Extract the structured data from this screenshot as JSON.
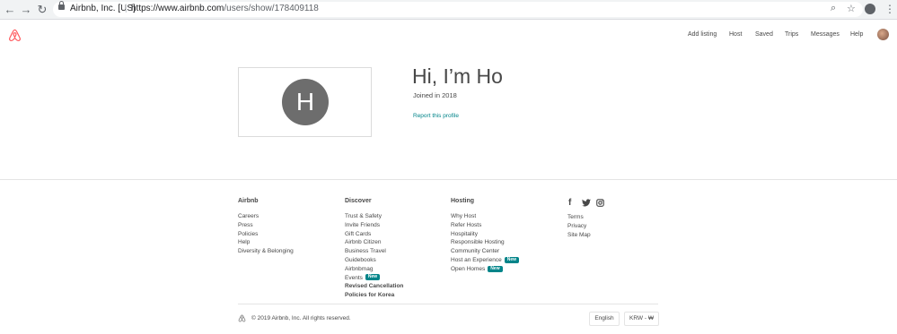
{
  "browser": {
    "organization": "Airbnb, Inc. [US]",
    "url_host": "https://www.airbnb.com",
    "url_path": "/users/show/178409118"
  },
  "header": {
    "nav": [
      "Add listing",
      "Host",
      "Saved",
      "Trips",
      "Messages",
      "Help"
    ]
  },
  "profile": {
    "avatar_initial": "H",
    "greeting": "Hi, I’m Ho",
    "joined": "Joined in 2018",
    "report_link": "Report this profile"
  },
  "footer": {
    "airbnb": {
      "title": "Airbnb",
      "links": [
        "Careers",
        "Press",
        "Policies",
        "Help",
        "Diversity & Belonging"
      ]
    },
    "discover": {
      "title": "Discover",
      "links": [
        "Trust & Safety",
        "Invite Friends",
        "Gift Cards",
        "Airbnb Citizen",
        "Business Travel",
        "Guidebooks",
        "Airbnbmag"
      ],
      "events_label": "Events",
      "events_badge": "New",
      "revised_line1": "Revised Cancellation",
      "revised_line2": "Policies for Korea"
    },
    "hosting": {
      "title": "Hosting",
      "links": [
        "Why Host",
        "Refer Hosts",
        "Hospitality",
        "Responsible Hosting",
        "Community Center"
      ],
      "experience_label": "Host an Experience",
      "experience_badge": "New",
      "homes_label": "Open Homes",
      "homes_badge": "New"
    },
    "misc": {
      "links": [
        "Terms",
        "Privacy",
        "Site Map"
      ]
    },
    "copyright": "© 2019 Airbnb, Inc. All rights reserved.",
    "language": "English",
    "currency": "KRW - ₩"
  },
  "colors": {
    "accent": "#008489",
    "brand": "#ff5a5f",
    "avatar_bg": "#6d6d6d"
  }
}
